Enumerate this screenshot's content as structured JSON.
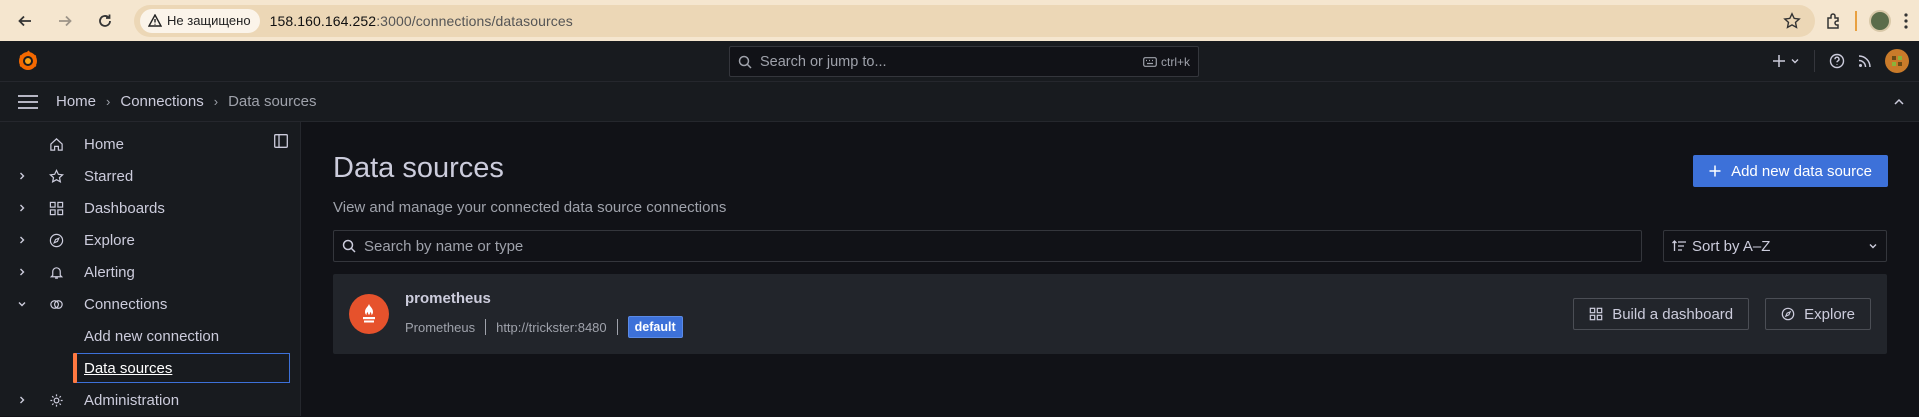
{
  "browser": {
    "security_label": "Не защищено",
    "url_host": "158.160.164.252",
    "url_rest": ":3000/connections/datasources"
  },
  "topbar": {
    "search_placeholder": "Search or jump to...",
    "shortcut": "ctrl+k"
  },
  "breadcrumb": {
    "items": [
      "Home",
      "Connections",
      "Data sources"
    ]
  },
  "sidebar": {
    "items": [
      {
        "label": "Home"
      },
      {
        "label": "Starred"
      },
      {
        "label": "Dashboards"
      },
      {
        "label": "Explore"
      },
      {
        "label": "Alerting"
      },
      {
        "label": "Connections"
      },
      {
        "label": "Administration"
      }
    ],
    "sub_items": [
      {
        "label": "Add new connection"
      },
      {
        "label": "Data sources"
      }
    ]
  },
  "page": {
    "title": "Data sources",
    "subtitle": "View and manage your connected data source connections",
    "add_button": "Add new data source",
    "search_placeholder": "Search by name or type",
    "sort_value": "Sort by A–Z"
  },
  "datasource": {
    "name": "prometheus",
    "type": "Prometheus",
    "url": "http://trickster:8480",
    "badge": "default",
    "build_button": "Build a dashboard",
    "explore_button": "Explore"
  },
  "colors": {
    "accent": "#3d71d9",
    "grafana_orange": "#ff7941",
    "prometheus": "#e6522c"
  }
}
